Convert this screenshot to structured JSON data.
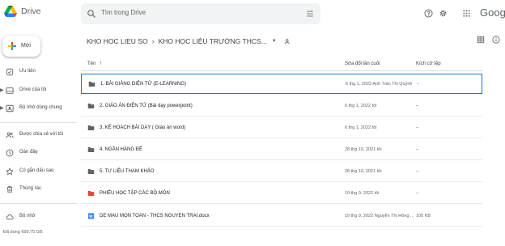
{
  "app": {
    "title": "Drive",
    "google_text": "Google"
  },
  "search": {
    "placeholder": "Tìm trong Drive"
  },
  "sidebar": {
    "new_label": "Mới",
    "items": [
      {
        "label": "Ưu tiên",
        "icon": "check-circle-icon"
      },
      {
        "label": "Drive của tôi",
        "icon": "my-drive-icon"
      },
      {
        "label": "Bộ nhớ dùng chung",
        "icon": "shared-drive-icon"
      },
      {
        "label": "Được chia sẻ với tôi",
        "icon": "people-icon"
      },
      {
        "label": "Gần đây",
        "icon": "clock-icon"
      },
      {
        "label": "Có gắn dấu sao",
        "icon": "star-icon"
      },
      {
        "label": "Thùng rác",
        "icon": "trash-icon"
      },
      {
        "label": "Bộ nhớ",
        "icon": "cloud-icon"
      }
    ],
    "storage_text": "Đã dùng 699,75 GB"
  },
  "breadcrumb": {
    "root": "KHO HOC LIEU SO",
    "current": "KHO HỌC LIỆU TRƯỜNG THCS..."
  },
  "table": {
    "headers": {
      "name": "Tên",
      "modified": "Sửa đổi lần cuối",
      "size": "Kích cỡ tệp"
    },
    "rows": [
      {
        "name": "1. BÀI GIẢNG ĐIỆN TỬ (E-LEARNING)",
        "modified": "6 thg 1, 2022  Anh Trần Thị Quỳnh",
        "size": "–",
        "type": "folder"
      },
      {
        "name": "2. GIÁO ÁN ĐIỆN TỬ  (Bài dạy powerpoint)",
        "modified": "6 thg 1, 2022 tôi",
        "size": "–",
        "type": "folder"
      },
      {
        "name": "3. KẾ HOẠCH BÀI DẠY ( Giáo án word)",
        "modified": "6 thg 1, 2022 tôi",
        "size": "–",
        "type": "folder"
      },
      {
        "name": "4. NGÂN HÀNG ĐỀ",
        "modified": "28 thg 10, 2021 tôi",
        "size": "–",
        "type": "folder"
      },
      {
        "name": "5. TƯ LIỆU THAM KHẢO",
        "modified": "28 thg 10, 2021 tôi",
        "size": "–",
        "type": "folder"
      },
      {
        "name": "PHIẾU HỌC TẬP CÁC BỘ MÔN",
        "modified": "19 thg 9, 2022 tôi",
        "size": "–",
        "type": "folder-red"
      },
      {
        "name": "DE MAU MON TOAN - THCS NGUYEN TRAI.docx",
        "modified": "19 thg 9, 2022  Nguyễn Thị Hồng ...",
        "size": "105 KB",
        "type": "word"
      }
    ]
  },
  "colors": {
    "accent": "#1a73e8",
    "folder": "#5f6368",
    "folder_red": "#ea4335",
    "word": "#4285f4"
  }
}
